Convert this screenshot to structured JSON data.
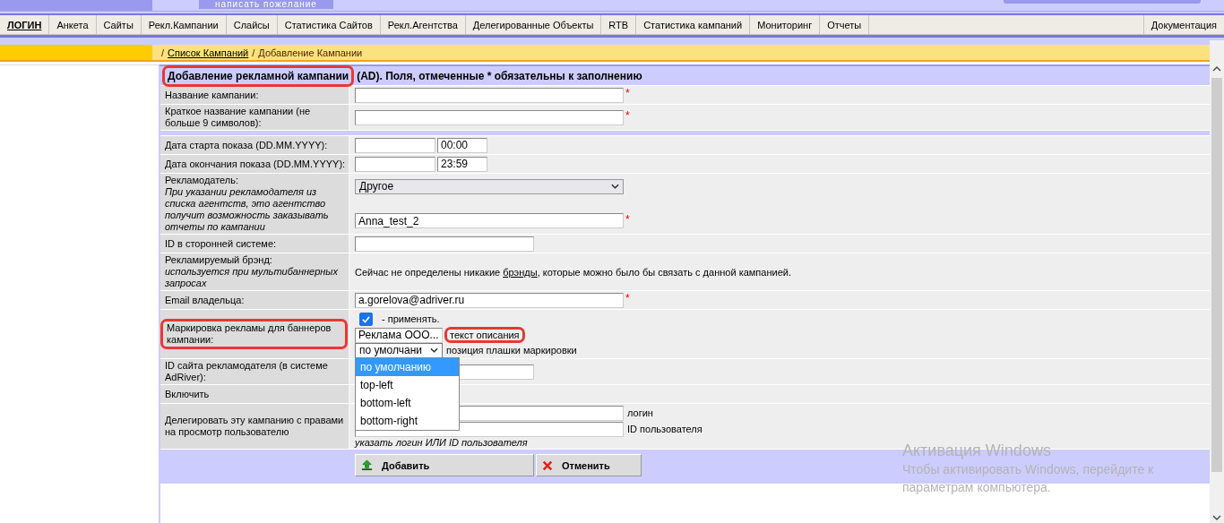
{
  "top_bar": {
    "feedback_button": "написать пожелание"
  },
  "nav": {
    "items": [
      {
        "label": "ЛОГИН",
        "selected": true
      },
      {
        "label": "Анкета",
        "selected": false
      },
      {
        "label": "Сайты",
        "selected": false
      },
      {
        "label": "Рекл.Кампании",
        "selected": false
      },
      {
        "label": "Слайсы",
        "selected": false
      },
      {
        "label": "Статистика Сайтов",
        "selected": false
      },
      {
        "label": "Рекл.Агентства",
        "selected": false
      },
      {
        "label": "Делегированные Объекты",
        "selected": false
      },
      {
        "label": "RTB",
        "selected": false
      },
      {
        "label": "Статистика кампаний",
        "selected": false
      },
      {
        "label": "Мониторинг",
        "selected": false
      },
      {
        "label": "Отчеты",
        "selected": false
      }
    ],
    "right_item": "Документация"
  },
  "breadcrumb": [
    {
      "kind": "sep",
      "text": "/"
    },
    {
      "kind": "link",
      "text": "Список Кампаний"
    },
    {
      "kind": "sep",
      "text": "/"
    },
    {
      "kind": "current",
      "text": "Добавление Кампании"
    }
  ],
  "form": {
    "title": [
      {
        "text": "Добавление рекламной кампании",
        "highlighted": true
      },
      {
        "text": "(AD). Поля, отмеченные * обязательны к заполнению",
        "highlighted": false
      }
    ],
    "rows": [
      {
        "kind": "text",
        "label": "Название кампании:",
        "value": "",
        "required_mark": "*"
      },
      {
        "kind": "text",
        "label": "Краткое название кампании (не больше 9 символов):",
        "value": "",
        "required_mark": "*"
      },
      {
        "kind": "divider"
      },
      {
        "kind": "date",
        "label": "Дата старта показа (DD.MM.YYYY):",
        "date": "",
        "time": "00:00"
      },
      {
        "kind": "date",
        "label": "Дата окончания показа (DD.MM.YYYY):",
        "date": "",
        "time": "23:59"
      },
      {
        "kind": "advertiser",
        "label": "Рекламодатель:",
        "hint": "При указании рекламодателя из списка агентств, это агентство получит возможность заказывать отчеты по кампании",
        "select": "Другое",
        "value": "Anna_test_2",
        "required_mark": "*"
      },
      {
        "kind": "short_text",
        "label": "ID в сторонней системе:",
        "value": ""
      },
      {
        "kind": "info",
        "label": "Рекламируемый брэнд:",
        "hint": "используется при мультибаннерных запросах",
        "text_before": "Сейчас не определены никакие ",
        "link": "брэнды",
        "text_after": ", которые можно было бы связать с данной кампанией."
      },
      {
        "kind": "text",
        "label": "Email владельца:",
        "value": "a.gorelova@adriver.ru",
        "required_mark": "*"
      },
      {
        "kind": "marking",
        "label": "Маркировка рекламы для баннеров кампании:",
        "label_highlighted": true,
        "checkbox": {
          "checked": true,
          "label": "- применять."
        },
        "value": "Реклама ООО...",
        "description": {
          "text": "текст описания",
          "highlighted": true
        },
        "position_select": "по умолчани",
        "position_label": "позиция плашки маркировки",
        "dropdown": [
          {
            "label": "по умолчанию",
            "selected": true
          },
          {
            "label": "top-left",
            "selected": false
          },
          {
            "label": "bottom-left",
            "selected": false
          },
          {
            "label": "bottom-right",
            "selected": false
          }
        ]
      },
      {
        "kind": "short_text",
        "label": "ID сайта рекламодателя (в системе AdRiver):",
        "value": ""
      },
      {
        "kind": "plain",
        "label": "Включить"
      },
      {
        "kind": "delegate",
        "label": "Делегировать эту кампанию с правами на просмотр пользователю",
        "login_label": "логин",
        "id_label": "ID пользователя",
        "hint": "указать логин ИЛИ ID пользователя"
      }
    ],
    "buttons": [
      {
        "kind": "add",
        "label": "Добавить"
      },
      {
        "kind": "cancel",
        "label": "Отменить"
      }
    ]
  },
  "os_overlay": {
    "title": "Активация Windows",
    "text": "Чтобы активировать Windows, перейдите к параметрам компьютера."
  }
}
